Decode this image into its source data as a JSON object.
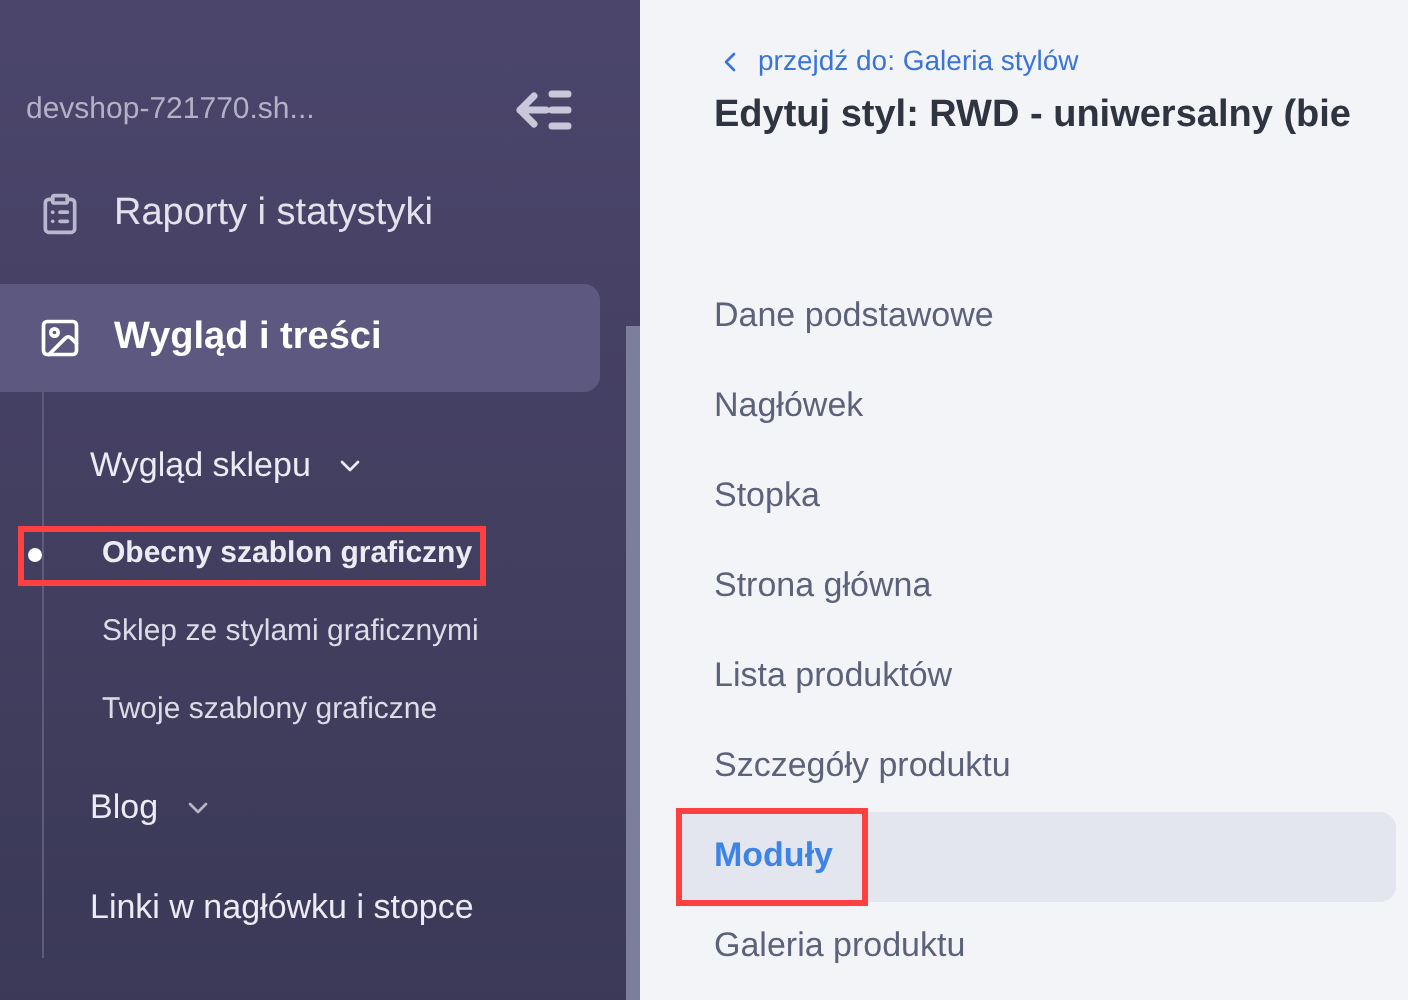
{
  "sidebar": {
    "shop": "devshop-721770.sh...",
    "items": [
      {
        "label": "Raporty i statystyki",
        "kind": "reports",
        "selected": false
      },
      {
        "label": "Wygląd i treści",
        "kind": "content",
        "selected": true,
        "children": [
          {
            "label": "Wygląd sklepu",
            "expanded": true,
            "children": [
              {
                "label": "Obecny szablon graficzny",
                "selected": true,
                "highlighted": true
              },
              {
                "label": "Sklep ze stylami graficznymi",
                "selected": false,
                "highlighted": false
              },
              {
                "label": "Twoje szablony graficzne",
                "selected": false,
                "highlighted": false
              }
            ]
          },
          {
            "label": "Blog",
            "expanded": false
          },
          {
            "label": "Linki w nagłówku i stopce"
          }
        ]
      }
    ]
  },
  "main": {
    "back_link": "przejdź do: Galeria stylów",
    "title": "Edytuj styl: RWD - uniwersalny (bie",
    "menu": [
      {
        "label": "Dane podstawowe",
        "selected": false,
        "highlighted": false
      },
      {
        "label": "Nagłówek",
        "selected": false,
        "highlighted": false
      },
      {
        "label": "Stopka",
        "selected": false,
        "highlighted": false
      },
      {
        "label": "Strona główna",
        "selected": false,
        "highlighted": false
      },
      {
        "label": "Lista produktów",
        "selected": false,
        "highlighted": false
      },
      {
        "label": "Szczegóły produktu",
        "selected": false,
        "highlighted": false
      },
      {
        "label": "Moduły",
        "selected": true,
        "highlighted": true
      },
      {
        "label": "Galeria produktu",
        "selected": false,
        "highlighted": false
      }
    ]
  }
}
